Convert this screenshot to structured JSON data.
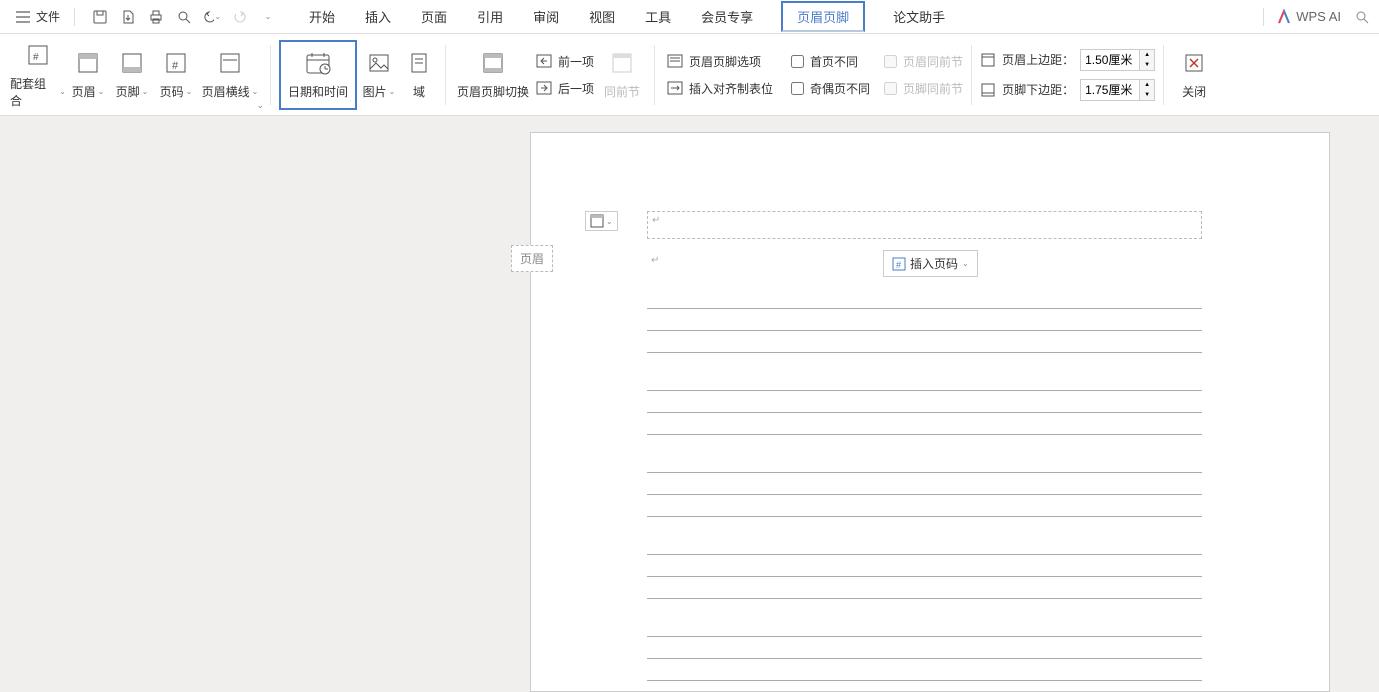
{
  "topbar": {
    "file": "文件",
    "tabs": [
      "开始",
      "插入",
      "页面",
      "引用",
      "审阅",
      "视图",
      "工具",
      "会员专享",
      "页眉页脚",
      "论文助手"
    ],
    "active_tab_index": 8,
    "wps_ai": "WPS AI"
  },
  "ribbon": {
    "group1": {
      "combo_set": "配套组合",
      "header": "页眉",
      "footer": "页脚",
      "page_number": "页码",
      "header_line": "页眉横线"
    },
    "group2": {
      "datetime": "日期和时间",
      "picture": "图片",
      "field": "域"
    },
    "group3": {
      "switch": "页眉页脚切换",
      "prev": "前一项",
      "next": "后一项",
      "same_prev": "同前节"
    },
    "group4": {
      "options": "页眉页脚选项",
      "insert_align": "插入对齐制表位",
      "first_diff": "首页不同",
      "odd_even_diff": "奇偶页不同",
      "header_same": "页眉同前节",
      "footer_same": "页脚同前节"
    },
    "group5": {
      "header_top": "页眉上边距：",
      "footer_bottom": "页脚下边距：",
      "header_top_val": "1.50厘米",
      "footer_bottom_val": "1.75厘米"
    },
    "close": "关闭"
  },
  "doc": {
    "header_tag": "页眉",
    "insert_pagenum": "插入页码"
  }
}
